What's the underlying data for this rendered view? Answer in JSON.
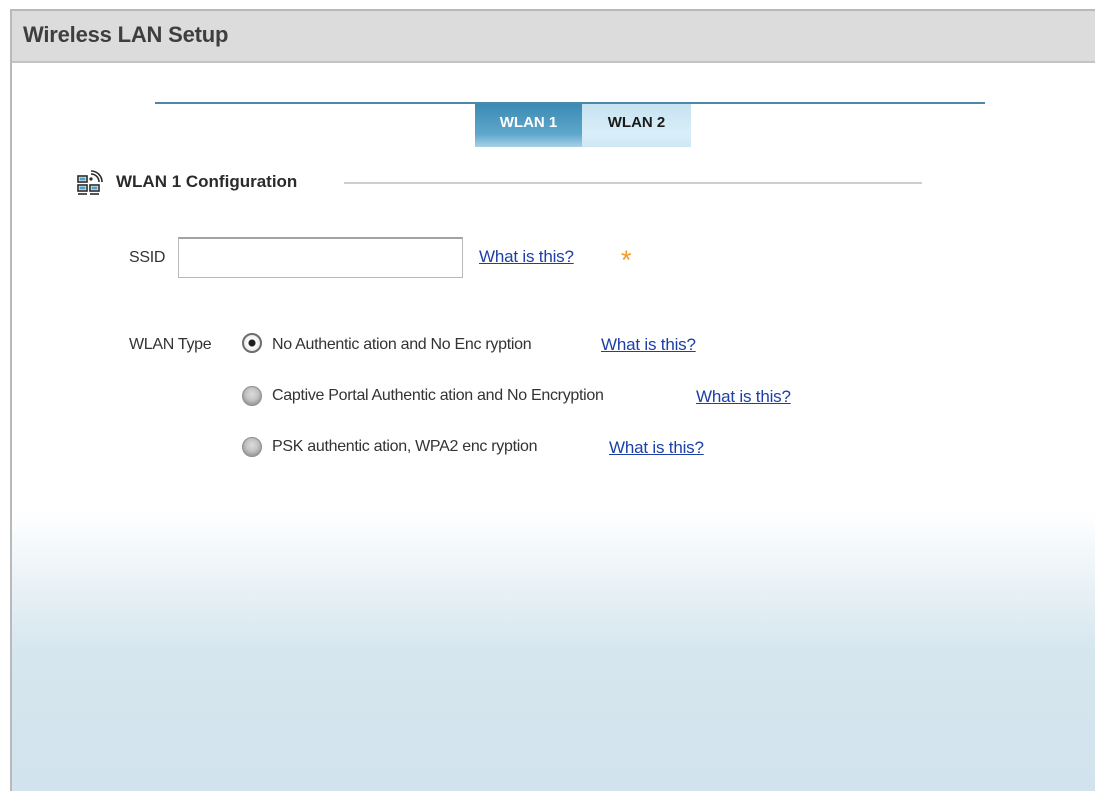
{
  "window": {
    "title": "Wireless LAN Setup"
  },
  "tabs": [
    {
      "label": "WLAN 1",
      "active": true
    },
    {
      "label": "WLAN 2",
      "active": false
    }
  ],
  "section": {
    "title": "WLAN 1 Configuration",
    "icon": "wireless-network-icon"
  },
  "ssid": {
    "label": "SSID",
    "value": "",
    "placeholder": "",
    "help_link": "What is this?",
    "required_marker": "*"
  },
  "wlan_type": {
    "label": "WLAN Type",
    "options": [
      {
        "label": "No Authentic ation and No Enc ryption",
        "selected": true,
        "help_link": "What is this?"
      },
      {
        "label": "Captive Portal Authentic ation and No Encryption",
        "selected": false,
        "help_link": "What is this?"
      },
      {
        "label": "PSK authentic ation, WPA2 enc ryption",
        "selected": false,
        "help_link": "What is this?"
      }
    ]
  },
  "colors": {
    "tab_active": "#3b8ab3",
    "tab_inactive": "#c6e3f1",
    "link": "#1c3fa8",
    "required_star": "#f39a2b",
    "title_bar": "#dcdcdc"
  }
}
